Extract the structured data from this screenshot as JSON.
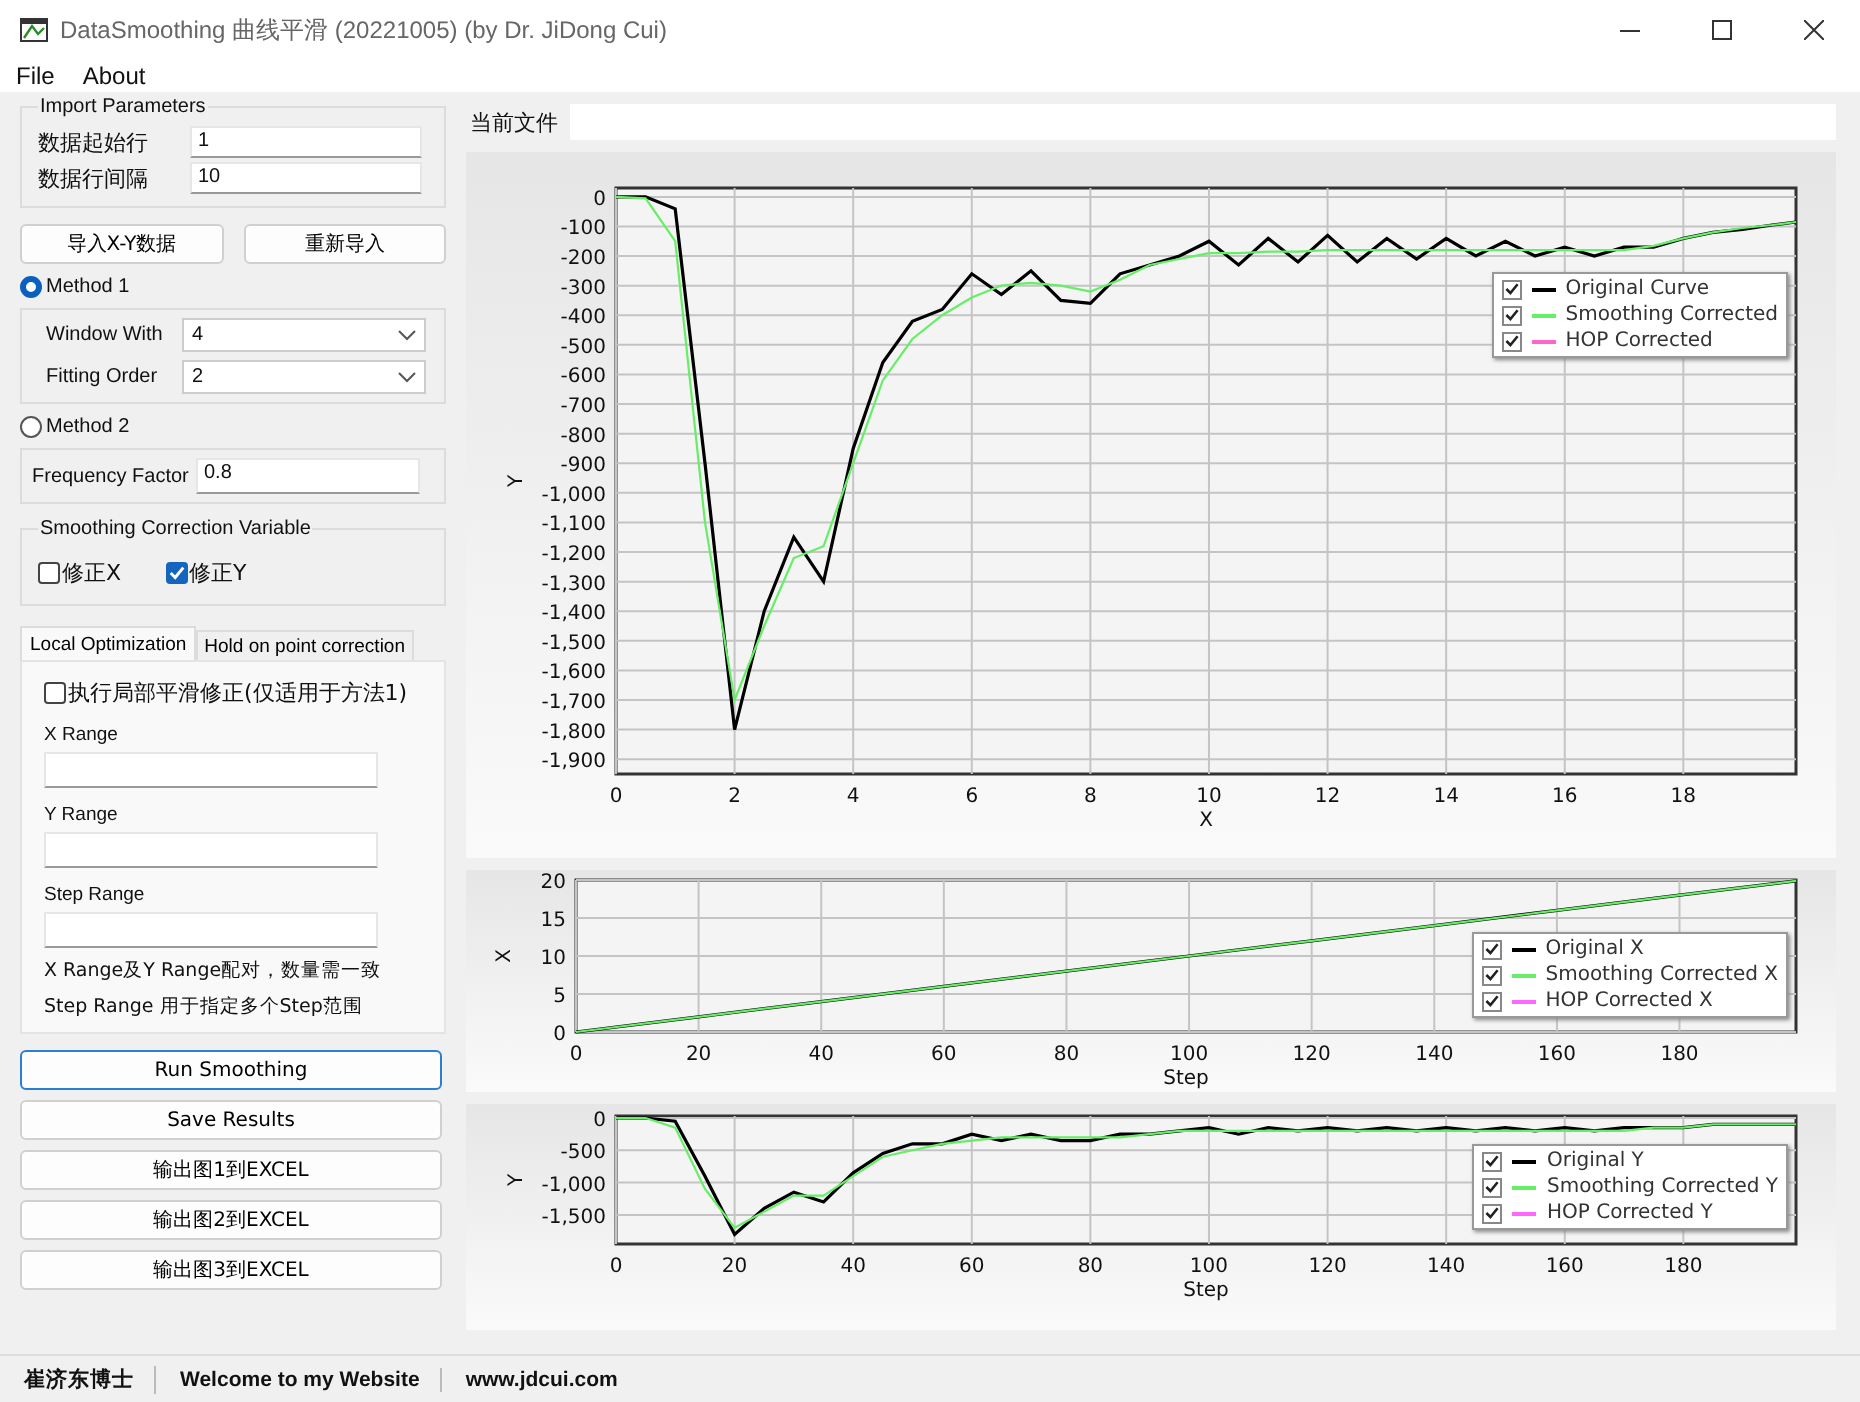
{
  "window": {
    "title": "DataSmoothing 曲线平滑 (20221005) (by Dr. JiDong Cui)"
  },
  "menu": [
    "File",
    "About"
  ],
  "import_parameters": {
    "title": "Import Parameters",
    "fields": [
      {
        "label": "数据起始行",
        "value": "1"
      },
      {
        "label": "数据行间隔",
        "value": "10"
      }
    ]
  },
  "import_buttons": [
    "导入X-Y数据",
    "重新导入"
  ],
  "methods": [
    {
      "label": "Method 1",
      "selected": true,
      "fields": [
        {
          "label": "Window With",
          "value": "4",
          "kind": "dropdown"
        },
        {
          "label": "Fitting Order",
          "value": "2",
          "kind": "dropdown"
        }
      ]
    },
    {
      "label": "Method 2",
      "selected": false,
      "fields": [
        {
          "label": "Frequency Factor",
          "value": "0.8",
          "kind": "text"
        }
      ]
    }
  ],
  "correction": {
    "title": "Smoothing Correction Variable",
    "options": [
      {
        "label": "修正X",
        "checked": false
      },
      {
        "label": "修正Y",
        "checked": true
      }
    ]
  },
  "tabs": [
    {
      "label": "Local Optimization",
      "selected": true
    },
    {
      "label": "Hold on point correction",
      "selected": false
    }
  ],
  "local_optimization": {
    "enable": {
      "label": "执行局部平滑修正(仅适用于方法1)",
      "checked": false
    },
    "ranges": [
      {
        "label": "X Range"
      },
      {
        "label": "Y Range"
      },
      {
        "label": "Step Range"
      }
    ],
    "notes": [
      "X Range及Y Range配对，数量需一致",
      "Step Range 用于指定多个Step范围"
    ]
  },
  "actions": [
    {
      "label": "Run Smoothing",
      "focused": true
    },
    {
      "label": "Save Results",
      "focused": false
    },
    {
      "label": "输出图1到EXCEL",
      "focused": false
    },
    {
      "label": "输出图2到EXCEL",
      "focused": false
    },
    {
      "label": "输出图3到EXCEL",
      "focused": false
    }
  ],
  "current_file": {
    "label": "当前文件"
  },
  "charts": [
    {
      "legend": [
        {
          "checked": true
        },
        {
          "checked": true
        },
        {
          "checked": true
        }
      ],
      "chart_data": {
        "type": "line",
        "grid": true,
        "xlabel": "X",
        "ylabel": "Y",
        "x": [
          0,
          0.5,
          1,
          1.5,
          2,
          2.5,
          3,
          3.5,
          4,
          4.5,
          5,
          5.5,
          6,
          6.5,
          7,
          7.5,
          8,
          8.5,
          9,
          9.5,
          10,
          10.5,
          11,
          11.5,
          12,
          12.5,
          13,
          13.5,
          14,
          14.5,
          15,
          15.5,
          16,
          16.5,
          17,
          17.5,
          18,
          18.5,
          19,
          19.5,
          19.9
        ],
        "xlim": [
          0,
          19.9
        ],
        "ylim": [
          -1950,
          30
        ],
        "xticks": [
          0,
          2,
          4,
          6,
          8,
          10,
          12,
          14,
          16,
          18
        ],
        "yticks": [
          0,
          -100,
          -200,
          -300,
          -400,
          -500,
          -600,
          -700,
          -800,
          -900,
          {
            "value": -1000,
            "label": "-1,000"
          },
          {
            "value": -1100,
            "label": "-1,100"
          },
          {
            "value": -1200,
            "label": "-1,200"
          },
          {
            "value": -1300,
            "label": "-1,300"
          },
          {
            "value": -1400,
            "label": "-1,400"
          },
          {
            "value": -1500,
            "label": "-1,500"
          },
          {
            "value": -1600,
            "label": "-1,600"
          },
          {
            "value": -1700,
            "label": "-1,700"
          },
          {
            "value": -1800,
            "label": "-1,800"
          },
          {
            "value": -1900,
            "label": "-1,900"
          }
        ],
        "series": [
          {
            "name": "Original Curve",
            "color": "#000000",
            "values": [
              0,
              0,
              -40,
              -900,
              -1800,
              -1400,
              -1150,
              -1300,
              -850,
              -560,
              -420,
              -380,
              -260,
              -330,
              -250,
              -350,
              -360,
              -260,
              -230,
              -200,
              -150,
              -230,
              -140,
              -220,
              -130,
              -220,
              -140,
              -210,
              -140,
              -200,
              -150,
              -200,
              -170,
              -200,
              -170,
              -170,
              -140,
              -120,
              -110,
              -95,
              -85
            ]
          },
          {
            "name": "Smoothing Corrected",
            "color": "#66ee66",
            "values": [
              0,
              -5,
              -150,
              -1100,
              -1700,
              -1450,
              -1220,
              -1180,
              -900,
              -620,
              -480,
              -400,
              -340,
              -300,
              -290,
              -300,
              -320,
              -280,
              -230,
              -210,
              -190,
              -190,
              -185,
              -185,
              -180,
              -180,
              -180,
              -180,
              -180,
              -180,
              -180,
              -180,
              -180,
              -180,
              -180,
              -165,
              -140,
              -120,
              -105,
              -95,
              -85
            ]
          },
          {
            "name": "HOP Corrected",
            "color": "#ff66cc",
            "values": [
              null,
              null,
              null,
              null,
              null,
              null,
              null,
              null,
              null,
              null,
              null,
              null,
              null,
              null,
              null,
              null,
              null,
              null,
              null,
              null,
              null,
              null,
              null,
              null,
              null,
              null,
              null,
              null,
              null,
              null,
              null,
              null,
              null,
              null,
              null,
              null,
              null,
              null,
              null,
              null,
              null
            ]
          }
        ]
      }
    },
    {
      "legend": [
        {
          "checked": true
        },
        {
          "checked": true
        },
        {
          "checked": true
        }
      ],
      "chart_data": {
        "type": "line",
        "grid": true,
        "xlabel": "Step",
        "ylabel": "X",
        "x": [
          0,
          20,
          40,
          60,
          80,
          100,
          120,
          140,
          160,
          180,
          199
        ],
        "xlim": [
          0,
          199
        ],
        "ylim": [
          0,
          20
        ],
        "xticks": [
          0,
          20,
          40,
          60,
          80,
          100,
          120,
          140,
          160,
          180
        ],
        "yticks": [
          0,
          5,
          10,
          15,
          20
        ],
        "series": [
          {
            "name": "Original X",
            "color": "#000000",
            "values": [
              0,
              2,
              4,
              6,
              8,
              10,
              12,
              14,
              16,
              18,
              19.9
            ]
          },
          {
            "name": "Smoothing Corrected X",
            "color": "#66ee66",
            "values": [
              0,
              2,
              4,
              6,
              8,
              10,
              12,
              14,
              16,
              18,
              19.9
            ]
          },
          {
            "name": "HOP Corrected X",
            "color": "#ff66ff",
            "values": [
              null,
              null,
              null,
              null,
              null,
              null,
              null,
              null,
              null,
              null,
              null
            ]
          }
        ]
      }
    },
    {
      "legend": [
        {
          "checked": true
        },
        {
          "checked": true
        },
        {
          "checked": true
        }
      ],
      "chart_data": {
        "type": "line",
        "grid": true,
        "xlabel": "Step",
        "ylabel": "Y",
        "x": [
          0,
          5,
          10,
          15,
          20,
          25,
          30,
          35,
          40,
          45,
          50,
          55,
          60,
          65,
          70,
          75,
          80,
          85,
          90,
          95,
          100,
          105,
          110,
          115,
          120,
          125,
          130,
          135,
          140,
          145,
          150,
          155,
          160,
          165,
          170,
          175,
          180,
          185,
          190,
          195,
          199
        ],
        "xlim": [
          0,
          199
        ],
        "ylim": [
          -1950,
          30
        ],
        "xticks": [
          0,
          20,
          40,
          60,
          80,
          100,
          120,
          140,
          160,
          180
        ],
        "yticks": [
          0,
          -500,
          {
            "value": -1000,
            "label": "-1,000"
          },
          {
            "value": -1500,
            "label": "-1,500"
          }
        ],
        "series": [
          {
            "name": "Original Y",
            "color": "#000000",
            "values": [
              0,
              0,
              -50,
              -900,
              -1800,
              -1400,
              -1150,
              -1300,
              -850,
              -550,
              -400,
              -400,
              -250,
              -350,
              -250,
              -350,
              -350,
              -250,
              -250,
              -200,
              -150,
              -250,
              -150,
              -200,
              -150,
              -200,
              -150,
              -200,
              -150,
              -200,
              -150,
              -200,
              -150,
              -200,
              -150,
              -150,
              -150,
              -100,
              -100,
              -100,
              -100
            ]
          },
          {
            "name": "Smoothing Corrected Y",
            "color": "#66ee66",
            "values": [
              0,
              0,
              -150,
              -1100,
              -1700,
              -1450,
              -1200,
              -1200,
              -900,
              -600,
              -500,
              -400,
              -350,
              -300,
              -300,
              -300,
              -300,
              -300,
              -250,
              -200,
              -200,
              -200,
              -200,
              -200,
              -200,
              -200,
              -200,
              -200,
              -200,
              -200,
              -200,
              -200,
              -200,
              -200,
              -200,
              -150,
              -150,
              -100,
              -100,
              -100,
              -100
            ]
          },
          {
            "name": "HOP Corrected Y",
            "color": "#ff66ff",
            "values": [
              null,
              null,
              null,
              null,
              null,
              null,
              null,
              null,
              null,
              null,
              null,
              null,
              null,
              null,
              null,
              null,
              null,
              null,
              null,
              null,
              null,
              null,
              null,
              null,
              null,
              null,
              null,
              null,
              null,
              null,
              null,
              null,
              null,
              null,
              null,
              null,
              null,
              null,
              null,
              null,
              null
            ]
          }
        ]
      }
    }
  ],
  "status_bar": [
    "崔济东博士",
    "Welcome to my Website",
    "www.jdcui.com"
  ]
}
